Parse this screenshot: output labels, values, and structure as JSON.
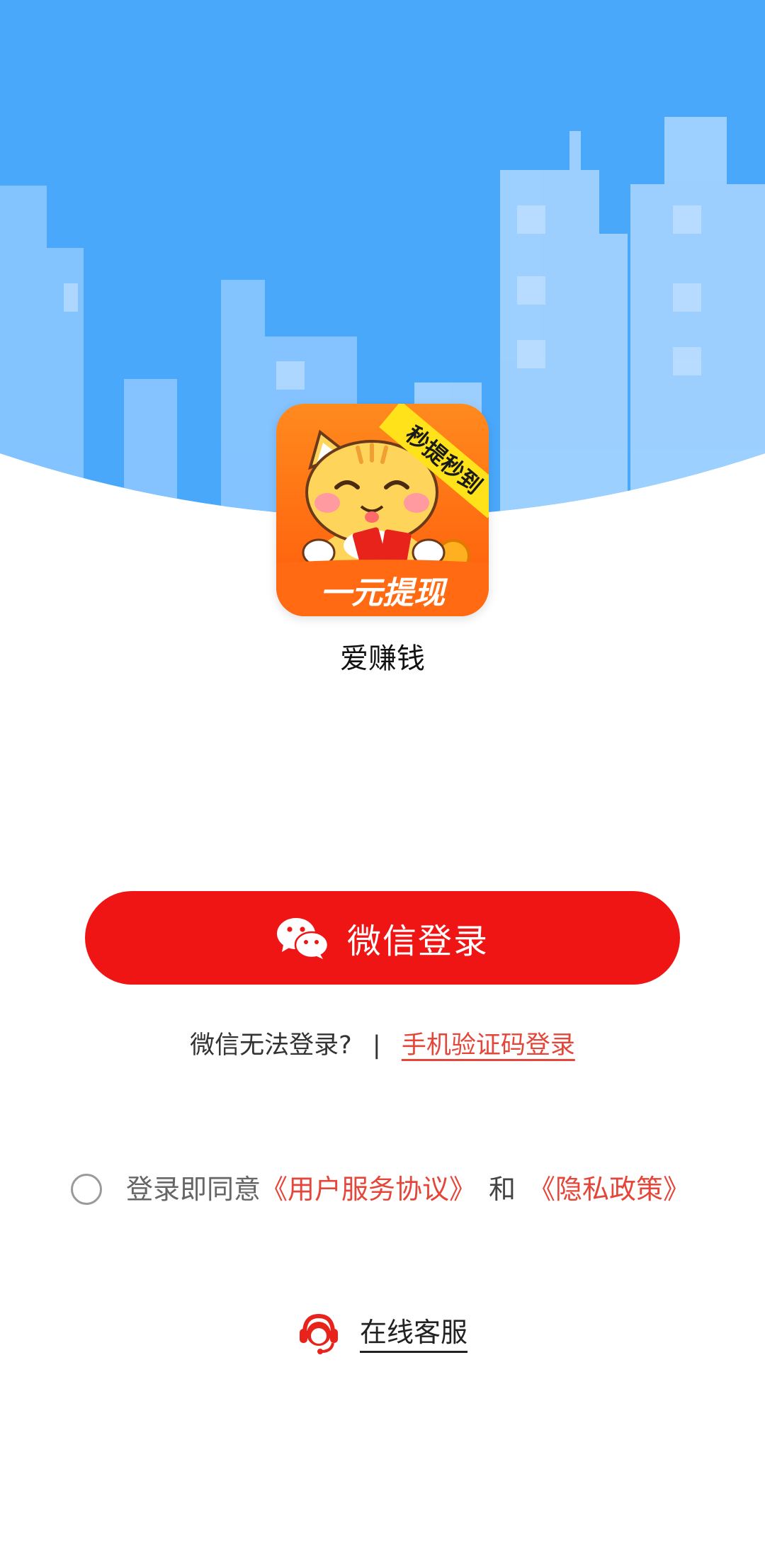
{
  "colors": {
    "sky": "#4aa8fb",
    "building_light": "#a6d4ff",
    "primary_red": "#f01515",
    "link_red": "#e5463a",
    "icon_orange": "#ff6a12"
  },
  "app": {
    "name": "爱赚钱",
    "icon_badge_text": "秒提秒到",
    "icon_banner_text": "一元提现"
  },
  "login": {
    "wechat_button_label": "微信登录",
    "wechat_icon": "wechat-icon",
    "alt_prompt": "微信无法登录?",
    "alt_separator": "|",
    "phone_login_link": "手机验证码登录"
  },
  "agreement": {
    "prefix": "登录即同意",
    "user_agreement": "《用户服务协议》",
    "conjunction": "和",
    "privacy_policy": "《隐私政策》",
    "checked": false
  },
  "support": {
    "label": "在线客服",
    "icon": "customer-service-icon"
  }
}
